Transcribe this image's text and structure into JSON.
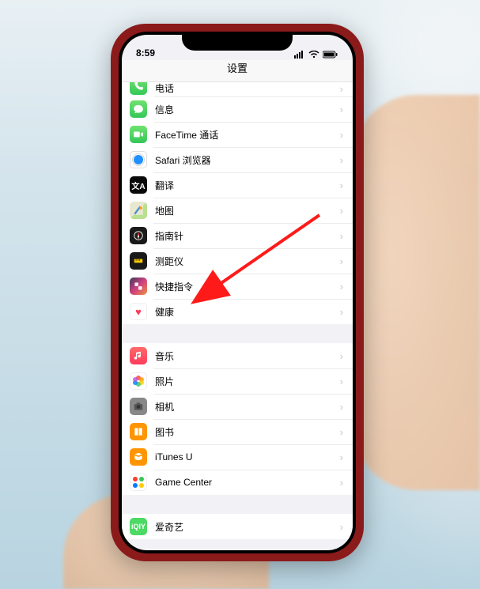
{
  "statusbar": {
    "time": "8:59"
  },
  "navbar": {
    "title": "设置"
  },
  "groups": [
    {
      "id": "g1",
      "items": [
        {
          "key": "phone",
          "label": "电话",
          "icon": "ic-phone",
          "icon_name": "phone-icon"
        },
        {
          "key": "messages",
          "label": "信息",
          "icon": "ic-msg",
          "icon_name": "messages-icon"
        },
        {
          "key": "facetime",
          "label": "FaceTime 通话",
          "icon": "ic-ft",
          "icon_name": "facetime-icon"
        },
        {
          "key": "safari",
          "label": "Safari 浏览器",
          "icon": "ic-safari",
          "icon_name": "safari-icon"
        },
        {
          "key": "translate",
          "label": "翻译",
          "icon": "ic-trans",
          "icon_name": "translate-icon"
        },
        {
          "key": "maps",
          "label": "地图",
          "icon": "ic-maps",
          "icon_name": "maps-icon"
        },
        {
          "key": "compass",
          "label": "指南针",
          "icon": "ic-compass",
          "icon_name": "compass-icon"
        },
        {
          "key": "measure",
          "label": "测距仪",
          "icon": "ic-measure",
          "icon_name": "measure-icon"
        },
        {
          "key": "shortcuts",
          "label": "快捷指令",
          "icon": "ic-shortcut",
          "icon_name": "shortcuts-icon"
        },
        {
          "key": "health",
          "label": "健康",
          "icon": "ic-health",
          "icon_name": "health-icon"
        }
      ]
    },
    {
      "id": "g2",
      "items": [
        {
          "key": "music",
          "label": "音乐",
          "icon": "ic-music",
          "icon_name": "music-icon"
        },
        {
          "key": "photos",
          "label": "照片",
          "icon": "ic-photos",
          "icon_name": "photos-icon"
        },
        {
          "key": "camera",
          "label": "相机",
          "icon": "ic-camera",
          "icon_name": "camera-icon"
        },
        {
          "key": "books",
          "label": "图书",
          "icon": "ic-books",
          "icon_name": "books-icon"
        },
        {
          "key": "itunesu",
          "label": "iTunes U",
          "icon": "ic-itunesu",
          "icon_name": "itunesu-icon"
        },
        {
          "key": "gc",
          "label": "Game Center",
          "icon": "ic-gc",
          "icon_name": "gamecenter-icon"
        }
      ]
    },
    {
      "id": "g3",
      "items": [
        {
          "key": "iqiyi",
          "label": "爱奇艺",
          "icon": "ic-iqiyi",
          "icon_name": "iqiyi-icon"
        }
      ]
    }
  ],
  "annotation": {
    "target_key": "shortcuts",
    "arrow_color": "#ff1a1a"
  }
}
